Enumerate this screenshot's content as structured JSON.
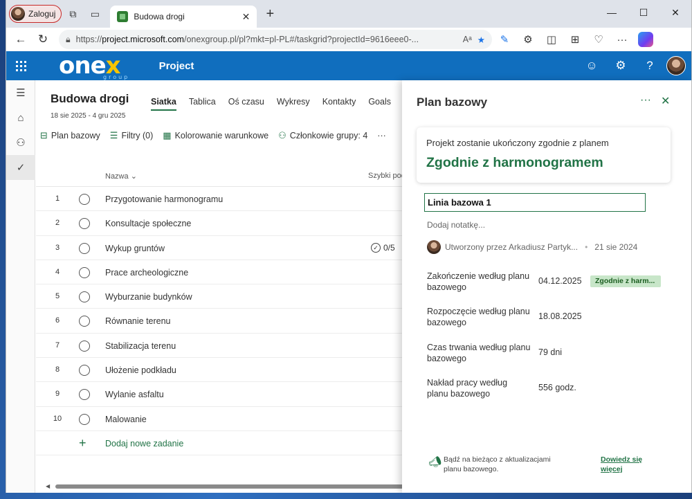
{
  "browser": {
    "profile_label": "Zaloguj",
    "tab_title": "Budowa drogi",
    "url_prefix": "https://",
    "url_host": "project.microsoft.com",
    "url_path": "/onexgroup.pl/pl?mkt=pl-PL#/taskgrid?projectId=9616eee0-...",
    "read_aloud_label": "Aᵃ"
  },
  "app": {
    "logo_main": "one",
    "logo_x": "x",
    "logo_sub": "group",
    "name": "Project"
  },
  "project": {
    "title": "Budowa drogi",
    "dates": "18 sie 2025 - 4 gru 2025",
    "tabs": [
      "Siatka",
      "Tablica",
      "Oś czasu",
      "Wykresy",
      "Kontakty",
      "Goals",
      "···"
    ],
    "toolbar": {
      "baseline": "Plan bazowy",
      "filters": "Filtry (0)",
      "conditional": "Kolorowanie warunkowe",
      "members": "Członkowie grupy: 4",
      "more": "···"
    },
    "columns": {
      "name": "Nazwa",
      "quick": "Szybki pod"
    },
    "tasks": [
      {
        "num": "1",
        "name": "Przygotowanie harmonogramu"
      },
      {
        "num": "2",
        "name": "Konsultacje społeczne"
      },
      {
        "num": "3",
        "name": "Wykup gruntów",
        "checklist": "0/5"
      },
      {
        "num": "4",
        "name": "Prace archeologiczne"
      },
      {
        "num": "5",
        "name": "Wyburzanie budynków"
      },
      {
        "num": "6",
        "name": "Równanie terenu"
      },
      {
        "num": "7",
        "name": "Stabilizacja terenu"
      },
      {
        "num": "8",
        "name": "Ułożenie podkładu"
      },
      {
        "num": "9",
        "name": "Wylanie asfaltu"
      },
      {
        "num": "10",
        "name": "Malowanie"
      }
    ],
    "add_task": "Dodaj nowe zadanie"
  },
  "panel": {
    "title": "Plan bazowy",
    "status_sub": "Projekt zostanie ukończony zgodnie z planem",
    "status_main": "Zgodnie z harmonogramem",
    "baseline_name": "Linia bazowa 1",
    "note_placeholder": "Dodaj notatkę...",
    "created_by": "Utworzony przez Arkadiusz Partyk...",
    "created_date": "21 sie 2024",
    "metrics": [
      {
        "label": "Zakończenie według planu bazowego",
        "value": "04.12.2025",
        "badge": "Zgodnie z harm..."
      },
      {
        "label": "Rozpoczęcie według planu bazowego",
        "value": "18.08.2025"
      },
      {
        "label": "Czas trwania według planu bazowego",
        "value": "79 dni"
      },
      {
        "label": "Nakład pracy według planu bazowego",
        "value": "556 godz."
      }
    ],
    "footer_text": "Bądź na bieżąco z aktualizacjami planu bazowego.",
    "footer_link": "Dowiedz się więcej"
  }
}
